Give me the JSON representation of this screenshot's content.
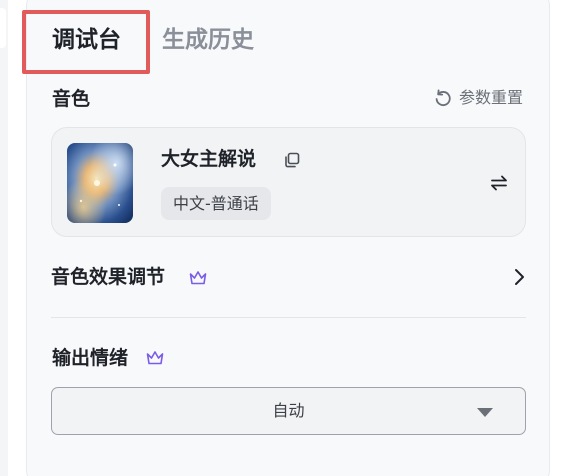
{
  "tabs": [
    {
      "label": "调试台",
      "active": true
    },
    {
      "label": "生成历史",
      "active": false
    }
  ],
  "voice": {
    "section_label": "音色",
    "reset_label": "参数重置",
    "name": "大女主解说",
    "language": "中文-普通话",
    "thumbnail_icon": "galaxy-thumbnail"
  },
  "effect": {
    "label": "音色效果调节",
    "premium_icon": "crown-icon"
  },
  "emotion": {
    "label": "输出情绪",
    "premium_icon": "crown-icon",
    "selected": "自动"
  },
  "colors": {
    "highlight": "#e25b5b",
    "crown": "#7b5ce6",
    "panel_bg": "#f8f9fb"
  }
}
